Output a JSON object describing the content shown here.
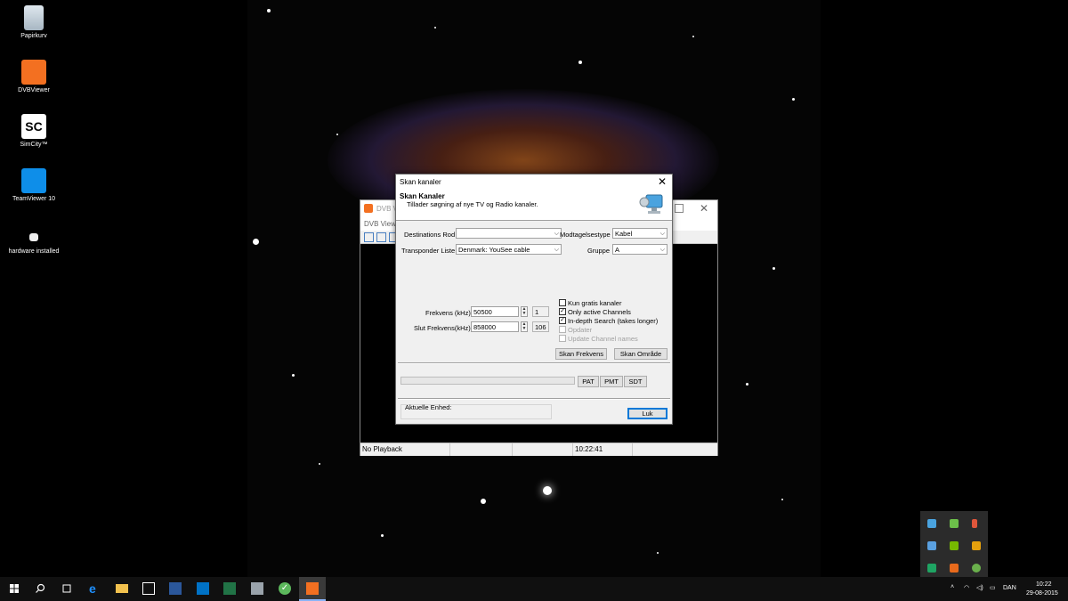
{
  "desktop": {
    "icons": [
      {
        "label": "Papirkurv",
        "icon": "recycle-bin-icon"
      },
      {
        "label": "DVBViewer",
        "icon": "dvbviewer-icon"
      },
      {
        "label": "SimCity™",
        "icon": "simcity-icon"
      },
      {
        "label": "TeamViewer 10",
        "icon": "teamviewer-icon"
      },
      {
        "label": "hardware installed",
        "icon": "document-icon"
      }
    ]
  },
  "dvb_window": {
    "title": "DVB V",
    "menu": "DVB View",
    "status": {
      "playback": "No Playback",
      "clock": "10:22:41"
    }
  },
  "dialog": {
    "title": "Skan kanaler",
    "heading": "Skan Kanaler",
    "subheading": "Tillader søgning af nye TV og Radio kanaler.",
    "destination_label": "Destinations Rod",
    "destination_value": "",
    "reception_label": "Modtagelsestype",
    "reception_value": "Kabel",
    "transponder_label": "Transponder Liste",
    "transponder_value": "Denmark: YouSee cable",
    "group_label": "Gruppe",
    "group_value": "A",
    "freq_label": "Frekvens (kHz)",
    "freq_value": "50500",
    "freq_count": "1",
    "end_freq_label": "Slut Frekvens(kHz)",
    "end_freq_value": "858000",
    "end_freq_count": "106",
    "checkboxes": [
      {
        "label": "Kun gratis kanaler",
        "checked": false,
        "disabled": false
      },
      {
        "label": "Only active Channels",
        "checked": true,
        "disabled": false
      },
      {
        "label": "In-depth Search (takes longer)",
        "checked": true,
        "disabled": false
      },
      {
        "label": "Opdater",
        "checked": false,
        "disabled": true
      },
      {
        "label": "Update Channel names",
        "checked": false,
        "disabled": true
      }
    ],
    "scan_freq_button": "Skan Frekvens",
    "scan_range_button": "Skan Område",
    "pat_button": "PAT",
    "pmt_button": "PMT",
    "sdt_button": "SDT",
    "current_device_label": "Aktuelle Enhed:",
    "current_device_value": "",
    "close_button": "Luk"
  },
  "taskbar": {
    "apps": [
      "start-icon",
      "search-icon",
      "task-view-icon",
      "edge-icon",
      "file-explorer-icon",
      "store-icon",
      "word-icon",
      "outlook-icon",
      "excel-icon",
      "app-icon",
      "green-check-icon",
      "dvbviewer-icon"
    ],
    "language": "DAN",
    "time": "10:22",
    "date": "29-08-2015"
  },
  "colors": {
    "accent": "#0078d7",
    "dvb_orange": "#f37021",
    "taskbar": "#101010"
  }
}
